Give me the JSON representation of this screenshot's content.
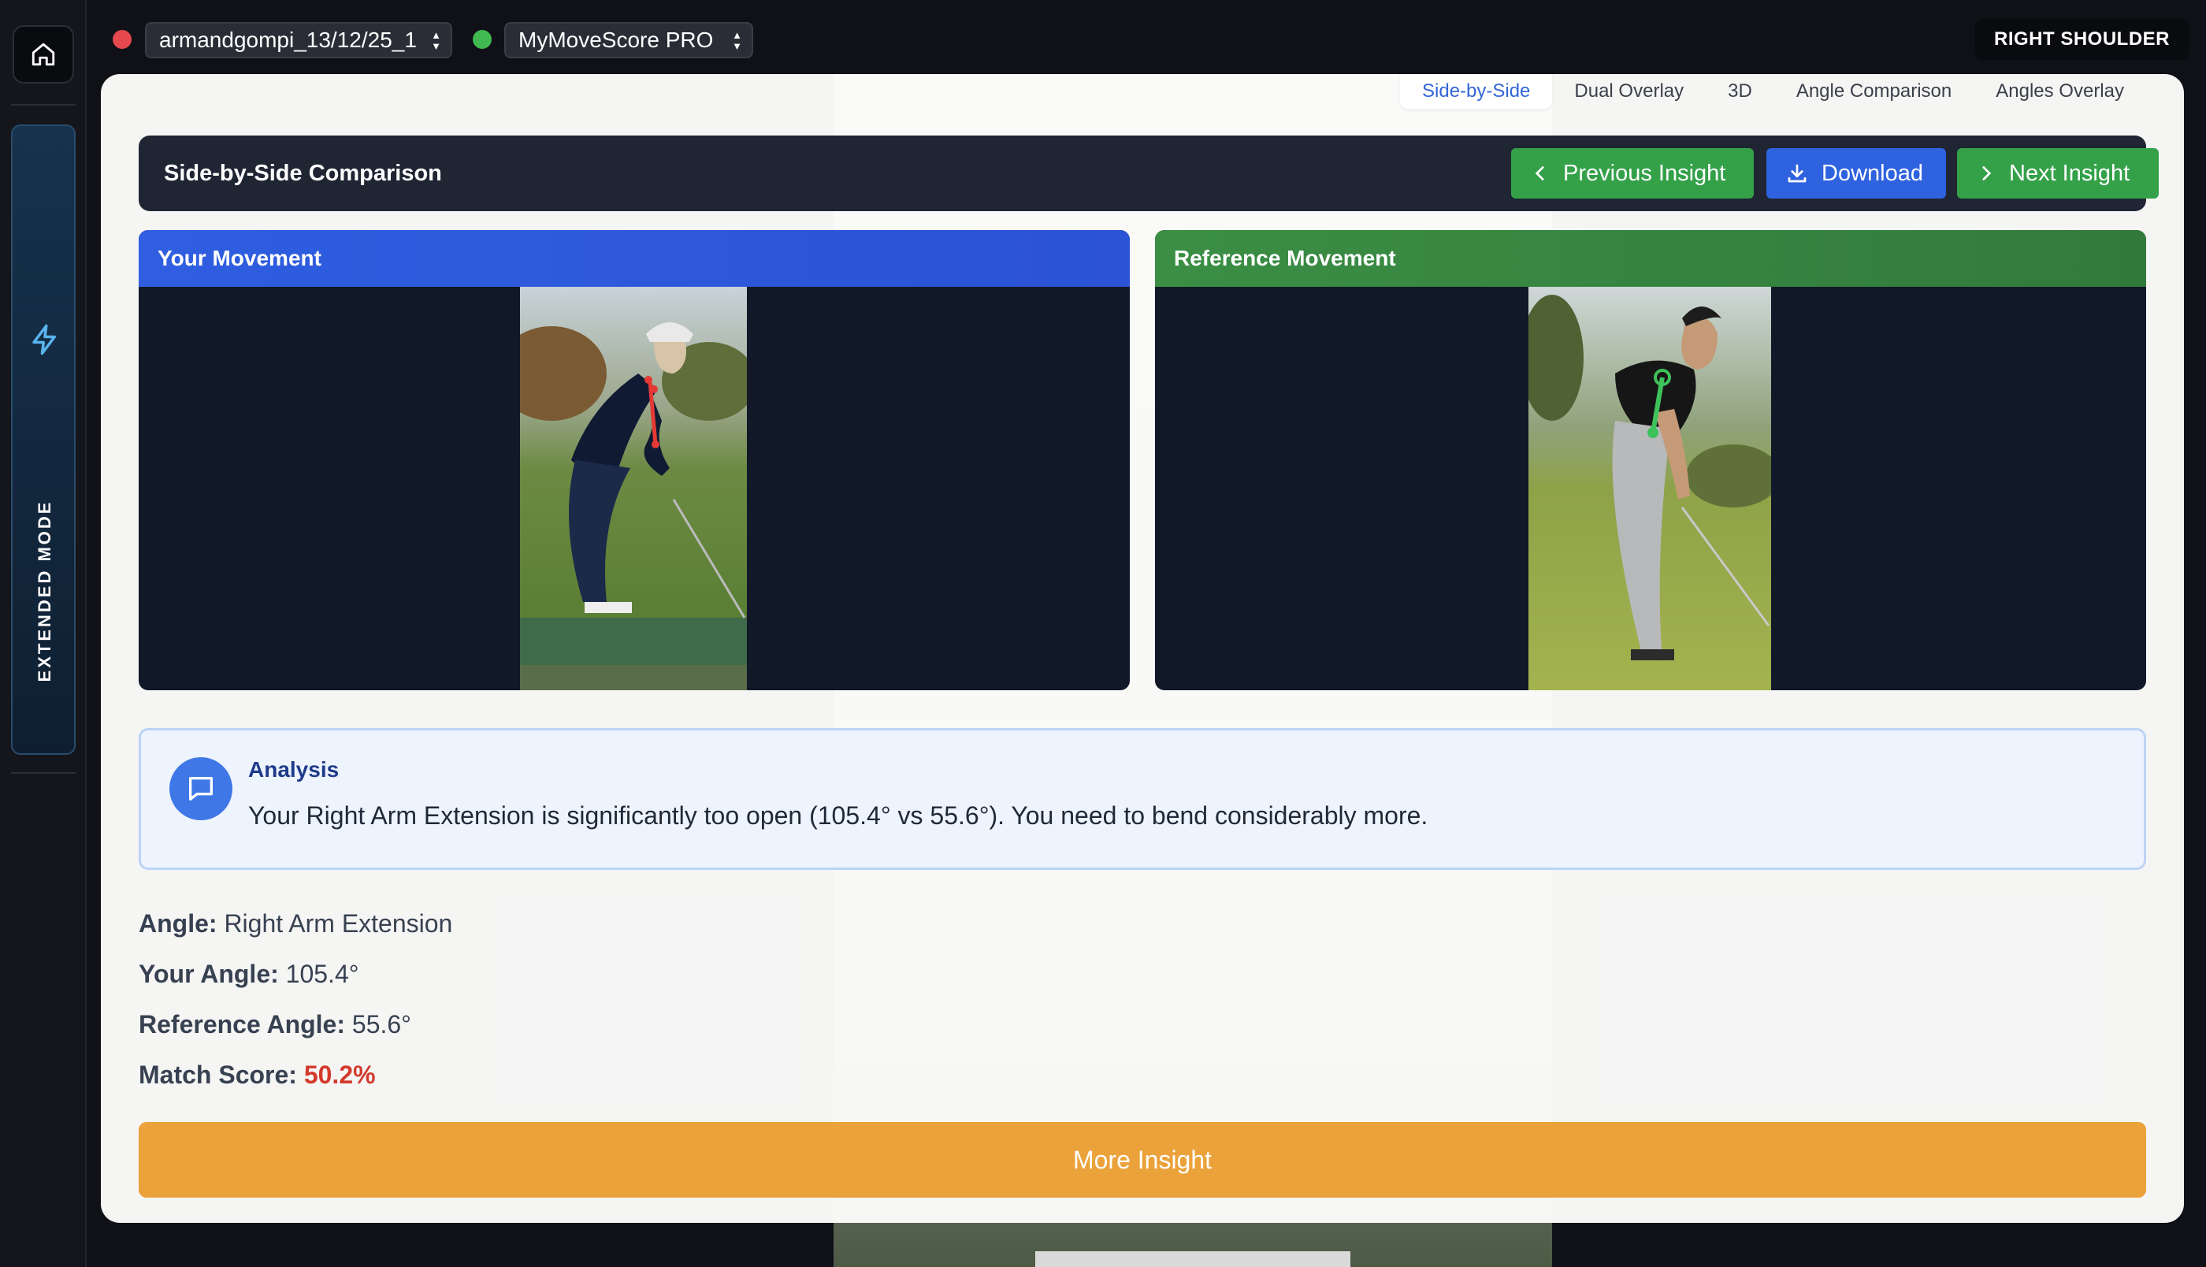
{
  "topbar": {
    "session_select": "armandgompi_13/12/25_1",
    "profile_select": "MyMoveScore PRO",
    "region_badge": "RIGHT SHOULDER",
    "colors": {
      "session_dot": "#e5484d",
      "profile_dot": "#3fb950"
    }
  },
  "sidebar": {
    "home_icon": "home-icon",
    "mode_icon": "lightning-bolt-icon",
    "mode_label": "EXTENDED MODE"
  },
  "tabs": [
    "Side-by-Side",
    "Dual Overlay",
    "3D",
    "Angle Comparison",
    "Angles Overlay"
  ],
  "active_tab": "Side-by-Side",
  "header": {
    "title": "Side-by-Side Comparison",
    "prev_label": "Previous Insight",
    "download_label": "Download",
    "next_label": "Next Insight"
  },
  "panels": {
    "your_label": "Your Movement",
    "reference_label": "Reference Movement"
  },
  "analysis": {
    "title": "Analysis",
    "text": "Your Right Arm Extension is significantly too open (105.4° vs 55.6°). You need to bend considerably more."
  },
  "stats": {
    "angle_label": "Angle:",
    "angle_value": "Right Arm Extension",
    "your_label": "Your Angle:",
    "your_value": "105.4°",
    "ref_label": "Reference Angle:",
    "ref_value": "55.6°",
    "score_label": "Match Score:",
    "score_value": "50.2%"
  },
  "more_button": "More Insight",
  "colors": {
    "accent_blue": "#2f62df",
    "accent_green": "#34a149",
    "warning_orange": "#eba23a",
    "score_red": "#d33a2c"
  }
}
